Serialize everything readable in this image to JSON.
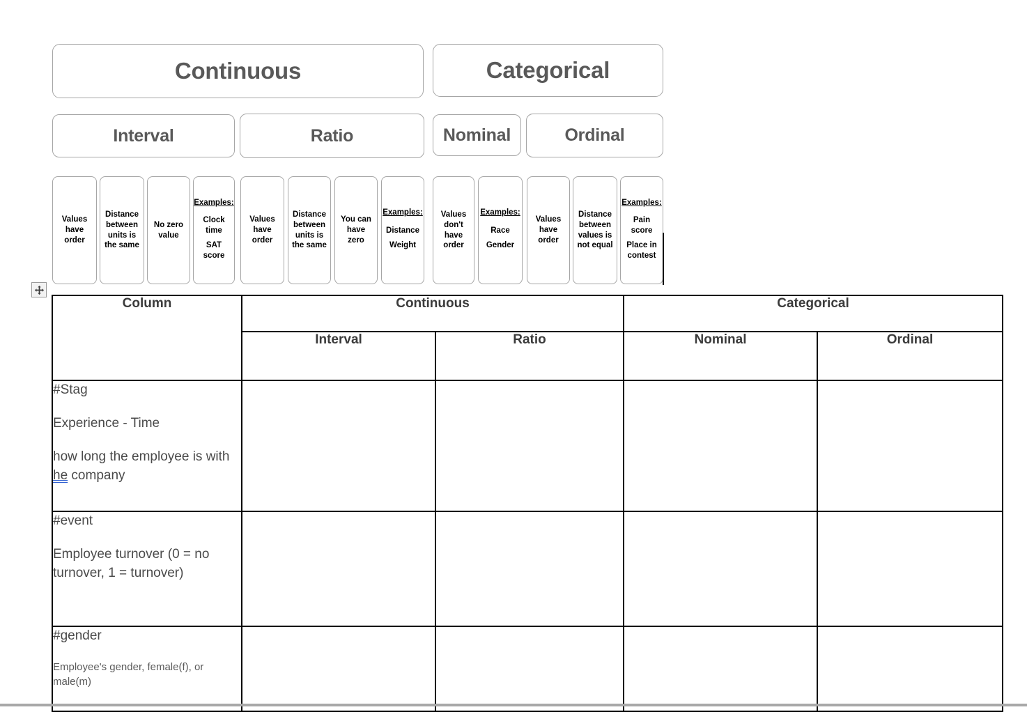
{
  "diagram": {
    "tier1": [
      {
        "label": "Continuous"
      },
      {
        "label": "Categorical"
      }
    ],
    "tier2": [
      {
        "label": "Interval"
      },
      {
        "label": "Ratio"
      },
      {
        "label": "Nominal"
      },
      {
        "label": "Ordinal"
      }
    ],
    "leaves": [
      {
        "type": "plain",
        "lines": [
          "Values",
          "have",
          "order"
        ]
      },
      {
        "type": "plain",
        "lines": [
          "Distance",
          "between",
          "units is",
          "the same"
        ]
      },
      {
        "type": "plain",
        "lines": [
          "No zero",
          "value"
        ]
      },
      {
        "type": "examples",
        "heading": "Examples:",
        "items": [
          "Clock time",
          "SAT score"
        ]
      },
      {
        "type": "plain",
        "lines": [
          "Values",
          "have",
          "order"
        ]
      },
      {
        "type": "plain",
        "lines": [
          "Distance",
          "between",
          "units is",
          "the same"
        ]
      },
      {
        "type": "plain",
        "lines": [
          "You can",
          "have",
          "zero"
        ]
      },
      {
        "type": "examples",
        "heading": "Examples:",
        "items": [
          "Distance",
          "Weight"
        ]
      },
      {
        "type": "plain",
        "lines": [
          "Values",
          "don't",
          "have",
          "order"
        ]
      },
      {
        "type": "examples",
        "heading": "Examples:",
        "items": [
          "Race",
          "Gender"
        ]
      },
      {
        "type": "plain",
        "lines": [
          "Values",
          "have",
          "order"
        ]
      },
      {
        "type": "plain",
        "lines": [
          "Distance",
          "between",
          "values is",
          "not equal"
        ]
      },
      {
        "type": "examples",
        "heading": "Examples:",
        "items": [
          "Pain score",
          "Place in contest"
        ]
      }
    ]
  },
  "table": {
    "header": {
      "column": "Column",
      "continuous": "Continuous",
      "categorical": "Categorical",
      "interval": "Interval",
      "ratio": "Ratio",
      "nominal": "Nominal",
      "ordinal": "Ordinal"
    },
    "rows": [
      {
        "name": "#Stag",
        "line2": "Experience - Time",
        "line3_before": "how long the employee is with ",
        "line3_grammar": "he",
        "line3_after": " company",
        "interval": "",
        "ratio": "",
        "nominal": "",
        "ordinal": ""
      },
      {
        "name": "#event",
        "line2": "Employee turnover (0 = no turnover, 1 = turnover)",
        "interval": "",
        "ratio": "",
        "nominal": "",
        "ordinal": ""
      },
      {
        "name": "#gender",
        "small": "Employee's gender, female(f), or male(m)",
        "interval": "",
        "ratio": "",
        "nominal": "",
        "ordinal": ""
      }
    ]
  },
  "colors": {
    "shape_border": "#a6a6a6",
    "shape_text": "#595959",
    "grid_border": "#000000",
    "grammar_underline": "#2f5fd0"
  }
}
